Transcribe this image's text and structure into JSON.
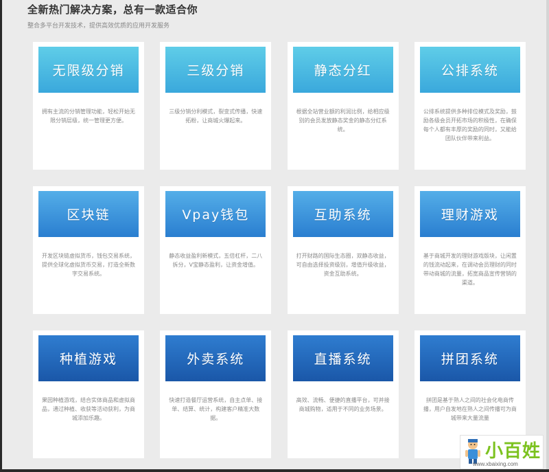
{
  "header": {
    "title": "全新热门解决方案，总有一款适合你",
    "subtitle": "整合多平台开发技术，提供高效优质的应用开发服务"
  },
  "cards": [
    {
      "title": "无限级分销",
      "desc": "拥有主流的分销管理功能，轻松开始无限分销层级，统一管理更方便。"
    },
    {
      "title": "三级分销",
      "desc": "三级分销分利模式，裂变式传播，快速拓粉，让商城火爆起来。"
    },
    {
      "title": "静态分红",
      "desc": "根据全站营业额的利润比例，给相应级别的会员发放静态奖金的静态分红系统。"
    },
    {
      "title": "公排系统",
      "desc": "公排系统提供多种排位模式及奖励，鼓励各级会员开拓市场的积极性，在确保每个人都有丰厚的奖励的同时，又能给团队伙伴带来利益。"
    },
    {
      "title": "区块链",
      "desc": "开发区块链虚拟货币，钱包交易系统，提供全球化虚拟货币交易，打造全新数字交易系统。"
    },
    {
      "title": "Vpay钱包",
      "desc": "静态收益盈利新模式，五倍杠杆，二八拆分，V宝静态盈利，让资金增值。"
    },
    {
      "title": "互助系统",
      "desc": "打开财路的国际生态圈，双静态收益，可自由选择投资级别，增值升级收益，资金互助系统。"
    },
    {
      "title": "理财游戏",
      "desc": "基于商城开发的理财游戏版块，让闲置的钱流动起来，在调动会员理财的同时带动商城的流量，拓宽商品宣传营销的渠道。"
    },
    {
      "title": "种植游戏",
      "desc": "果园种植游戏，结合实体商品和虚拟商品，通过种植、收获等活动获利，为商城添加乐趣。"
    },
    {
      "title": "外卖系统",
      "desc": "快速打造餐厅运营系统，自主点单、接单、结算、统计，构建客户精准大数据。"
    },
    {
      "title": "直播系统",
      "desc": "高效、流畅、便捷的直播平台，可并接商城购物，适用于不同的业务场景。"
    },
    {
      "title": "拼团系统",
      "desc": "拼团是基于熟人之间的社会化电商传播，用户自发地在熟人之间传播可为商城带来大量流量"
    }
  ],
  "watermark": {
    "title": "小百姓",
    "url": "www.xbaixing.com",
    "icon": "mascot-icon"
  }
}
